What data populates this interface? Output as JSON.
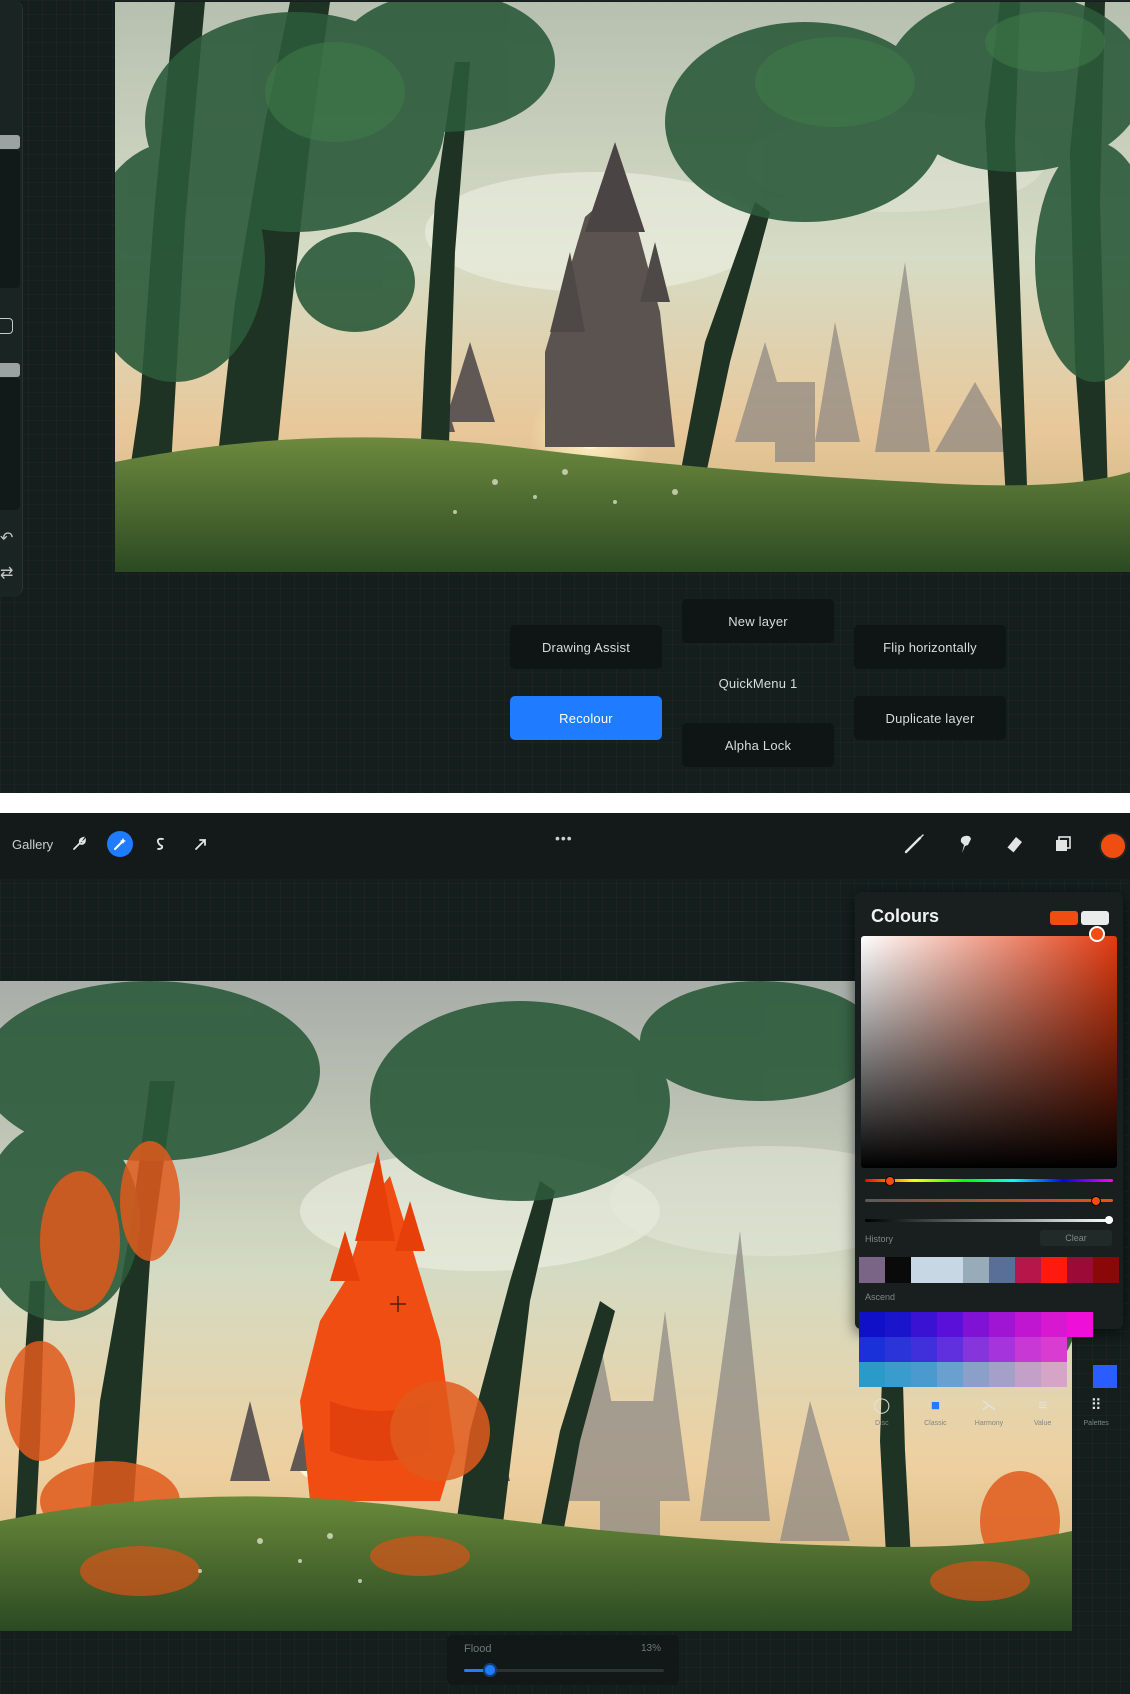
{
  "quickmenu": {
    "buttons": {
      "drawing_assist": "Drawing Assist",
      "new_layer": "New layer",
      "flip_horizontally": "Flip horizontally",
      "quickmenu_1": "QuickMenu 1",
      "recolour": "Recolour",
      "alpha_lock": "Alpha Lock",
      "duplicate_layer": "Duplicate layer"
    },
    "active": "Recolour",
    "accent": "#1f7bff"
  },
  "toolbar": {
    "gallery": "Gallery",
    "icons_left": [
      "wrench-icon",
      "magic-wand-icon",
      "selection-icon",
      "transform-arrow-icon"
    ],
    "more": "•••",
    "icons_right": [
      "brush-icon",
      "smudge-icon",
      "eraser-icon",
      "layers-icon"
    ],
    "current_color": "#f04d12"
  },
  "colours": {
    "title": "Colours",
    "primary": "#f04d12",
    "secondary": "#e9eceb",
    "history_label": "History",
    "clear_label": "Clear",
    "ascend_label": "Ascend",
    "history": [
      "#7a6586",
      "#0a0a0a",
      "#c7d7e3",
      "#c7d7e3",
      "#98abb8",
      "#5a6f98",
      "#b7164a",
      "#ff1a10",
      "#9c0a38",
      "#8a0808"
    ],
    "palette": [
      [
        "#1010c8",
        "#1a14cc",
        "#3a12d4",
        "#5a10d8",
        "#8012d6",
        "#a014d4",
        "#c016d2",
        "#d818d0",
        "#ee10d8"
      ],
      [
        "#1a30d8",
        "#2a34d8",
        "#4030dc",
        "#6030de",
        "#8634dc",
        "#a634dc",
        "#c838d4",
        "#d83cd0",
        ""
      ],
      [
        "#2a9ac8",
        "#3a9ccc",
        "#4a9ad0",
        "#6aa0d0",
        "#8aa0c8",
        "#a4a0c8",
        "#c2a0c8",
        "#d6a4c6",
        ""
      ]
    ],
    "palette_extra": "#2a5cff",
    "tabs": [
      {
        "icon": "disc-icon",
        "label": "Disc"
      },
      {
        "icon": "classic-icon",
        "label": "Classic"
      },
      {
        "icon": "harmony-icon",
        "label": "Harmony"
      },
      {
        "icon": "value-icon",
        "label": "Value"
      },
      {
        "icon": "palettes-icon",
        "label": "Palettes"
      }
    ],
    "active_tab": "Classic"
  },
  "flood": {
    "label": "Flood",
    "value": "13%",
    "fraction": 0.13
  }
}
